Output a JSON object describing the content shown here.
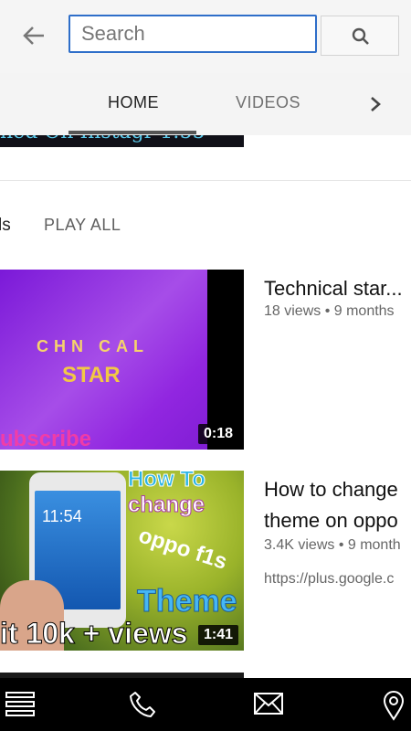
{
  "search": {
    "placeholder": "Search"
  },
  "tabs": [
    {
      "label": "HOME"
    },
    {
      "label": "VIDEOS"
    }
  ],
  "top_thumb": {
    "caption": "ned On Instagr  1:55"
  },
  "section": {
    "title": "ls",
    "play_all": "PLAY ALL"
  },
  "videos": [
    {
      "title": "Technical star...",
      "meta": "18 views • 9 months",
      "duration": "0:18",
      "thumb_text": [
        "CHN CAL",
        "STAR",
        "ubscribe"
      ]
    },
    {
      "title": "How to change theme on oppo",
      "meta": "3.4K views • 9 month",
      "description": "https://plus.google.c",
      "duration": "1:41",
      "thumb_text": [
        "11:54",
        "How To",
        "change",
        "oppo f1s",
        "Theme",
        "it 10k + views"
      ]
    }
  ],
  "bottom_nav": [
    "menu-icon",
    "phone-icon",
    "mail-icon",
    "location-pin-icon"
  ],
  "colors": {
    "accent": "#2e6ec9",
    "nav_bg": "#000000",
    "tab_underline": "#555555"
  }
}
